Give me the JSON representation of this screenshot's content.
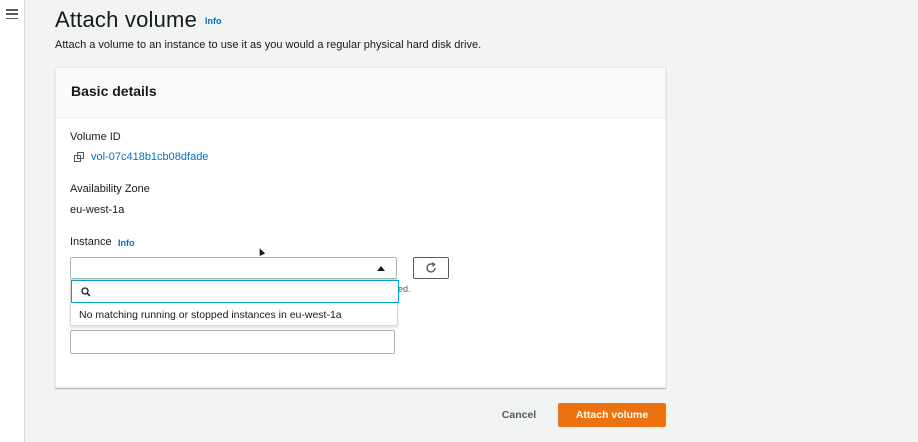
{
  "page": {
    "title": "Attach volume",
    "title_info": "Info",
    "description": "Attach a volume to an instance to use it as you would a regular physical hard disk drive."
  },
  "nav": {
    "menu_icon": "hamburger-menu-icon"
  },
  "panel": {
    "header": "Basic details",
    "volume_id_label": "Volume ID",
    "volume_id": "vol-07c418b1cb08dfade",
    "copy_icon": "copy-icon",
    "az_label": "Availability Zone",
    "az_value": "eu-west-1a",
    "instance_label": "Instance",
    "instance_info": "Info",
    "instance_value": "",
    "refresh_icon": "refresh-icon",
    "hint_fragment": "ed.",
    "dropdown": {
      "search_value": "",
      "search_icon": "search-icon",
      "empty_message": "No matching running or stopped instances in eu-west-1a"
    },
    "device_name_value": ""
  },
  "actions": {
    "cancel": "Cancel",
    "attach": "Attach volume"
  },
  "colors": {
    "primary": "#ec7211",
    "link": "#0073bb",
    "focus": "#00a1c9",
    "background": "#f2f3f3"
  }
}
